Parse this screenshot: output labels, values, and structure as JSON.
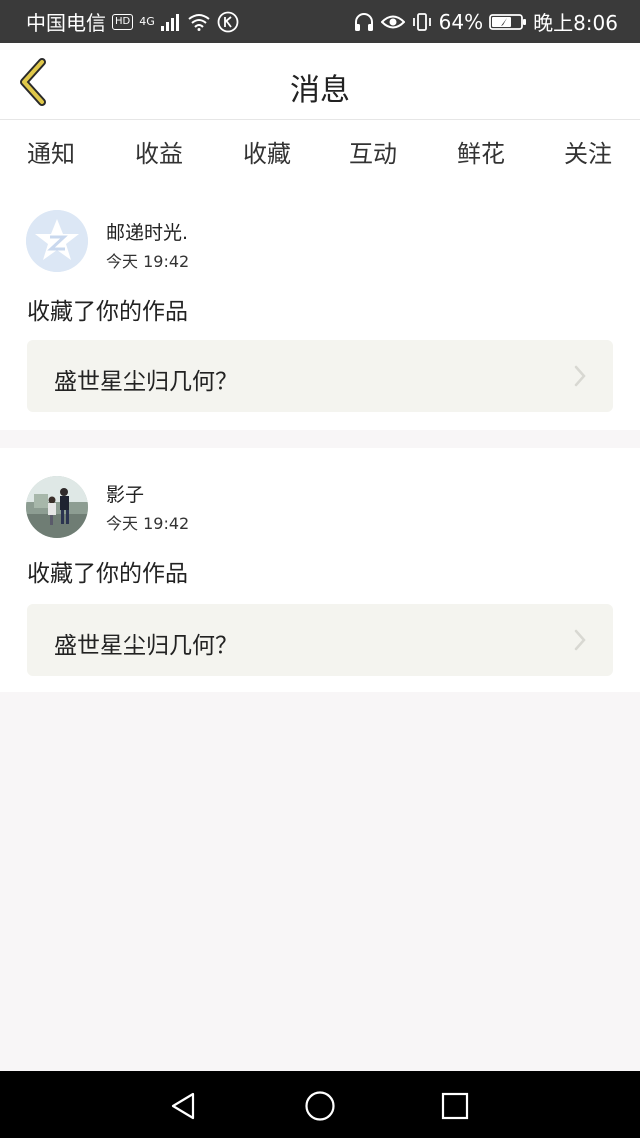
{
  "status_bar": {
    "carrier": "中国电信",
    "hd_badge": "HD",
    "network": "4G",
    "battery": "64%",
    "time": "晚上8:06",
    "icons": [
      "signal-icon",
      "wifi-icon",
      "k-app-icon",
      "headphones-icon",
      "eye-icon",
      "vibrate-icon",
      "battery-icon"
    ]
  },
  "header": {
    "title": "消息",
    "back_icon": "chevron-left-icon",
    "accent_color": "#e0c84a"
  },
  "tabs": {
    "items": [
      {
        "label": "通知"
      },
      {
        "label": "收益"
      },
      {
        "label": "收藏"
      },
      {
        "label": "互动"
      },
      {
        "label": "鲜花"
      },
      {
        "label": "关注"
      }
    ],
    "active_index": 2,
    "indicator_color": "#e07aa6"
  },
  "messages": [
    {
      "username": "邮递时光.",
      "time": "今天 19:42",
      "action": "收藏了你的作品",
      "work_title": "盛世星尘归几何？",
      "avatar": "star-logo-avatar"
    },
    {
      "username": "影子",
      "time": "今天 19:42",
      "action": "收藏了你的作品",
      "work_title": "盛世星尘归几何？",
      "avatar": "photo-avatar"
    }
  ],
  "system_nav": {
    "icons": [
      "back-triangle-icon",
      "home-circle-icon",
      "recents-square-icon"
    ]
  }
}
